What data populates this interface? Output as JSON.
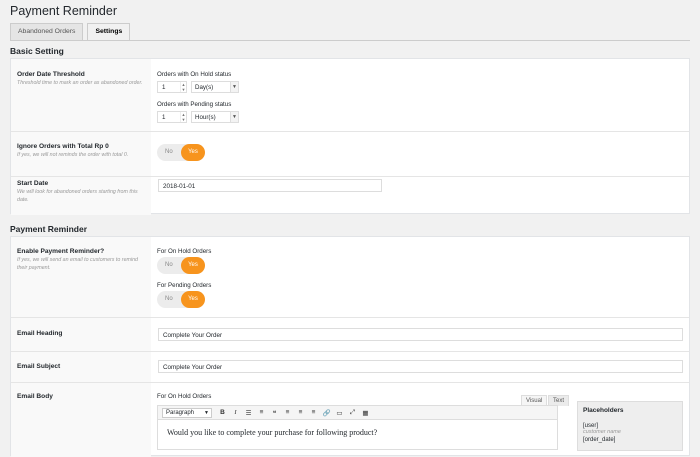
{
  "page": {
    "title": "Payment Reminder"
  },
  "tabs": [
    {
      "label": "Abandoned Orders",
      "active": false
    },
    {
      "label": "Settings",
      "active": true
    }
  ],
  "basic": {
    "title": "Basic Setting",
    "threshold": {
      "label": "Order Date Threshold",
      "desc": "Threshold time to mark an order as abandoned order.",
      "on_hold_label": "Orders with On Hold status",
      "on_hold_value": "1",
      "on_hold_unit": "Day(s)",
      "pending_label": "Orders with Pending status",
      "pending_value": "1",
      "pending_unit": "Hour(s)"
    },
    "ignore": {
      "label": "Ignore Orders with Total Rp 0",
      "desc": "If yes, we will not reminds the order with total 0.",
      "no": "No",
      "yes": "Yes",
      "value": "Yes"
    },
    "start_date": {
      "label": "Start Date",
      "desc": "We will look for abandoned orders starting from this date.",
      "value": "2018-01-01"
    }
  },
  "reminder": {
    "title": "Payment Reminder",
    "enable": {
      "label": "Enable Payment Reminder?",
      "desc": "If yes, we will send an email to customers to remind their payment.",
      "on_hold_label": "For On Hold Orders",
      "pending_label": "For Pending Orders",
      "no": "No",
      "yes": "Yes",
      "on_hold_value": "Yes",
      "pending_value": "Yes"
    },
    "heading": {
      "label": "Email Heading",
      "value": "Complete Your Order"
    },
    "subject": {
      "label": "Email Subject",
      "value": "Complete Your Order"
    },
    "body": {
      "label": "Email Body",
      "for_label": "For On Hold Orders",
      "tab_visual": "Visual",
      "tab_text": "Text",
      "format": "Paragraph",
      "content": "Would you like to complete your purchase for following product?"
    },
    "placeholders": {
      "title": "Placeholders",
      "items": [
        {
          "tag": "[user]",
          "desc": "customer name"
        },
        {
          "tag": "[order_date]",
          "desc": ""
        }
      ]
    }
  },
  "colors": {
    "accent": "#f7941d",
    "toggle_off": "#ececec"
  }
}
